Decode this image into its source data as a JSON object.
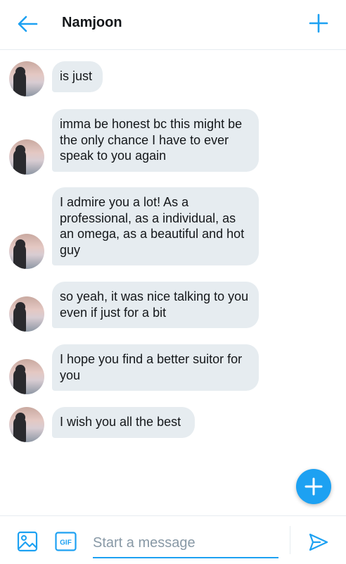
{
  "header": {
    "title": "Namjoon",
    "back_icon": "arrow-left-icon",
    "action_icon": "plus-icon"
  },
  "messages": [
    {
      "text": "is just"
    },
    {
      "text": "imma be honest bc this might be the only chance I have to ever speak to you again"
    },
    {
      "text": "I admire you a lot! As a professional, as a individual, as an omega, as a beautiful and hot guy"
    },
    {
      "text": "so yeah, it was nice talking to you even if just for a bit"
    },
    {
      "text": "I hope you find a better suitor for you"
    },
    {
      "text": "I wish you all the best"
    }
  ],
  "composer": {
    "placeholder": "Start a message",
    "gif_label": "GIF"
  },
  "colors": {
    "accent": "#1da1f2",
    "bubble": "#e6ecf0",
    "text": "#14171a",
    "placeholder": "#8899a6"
  }
}
